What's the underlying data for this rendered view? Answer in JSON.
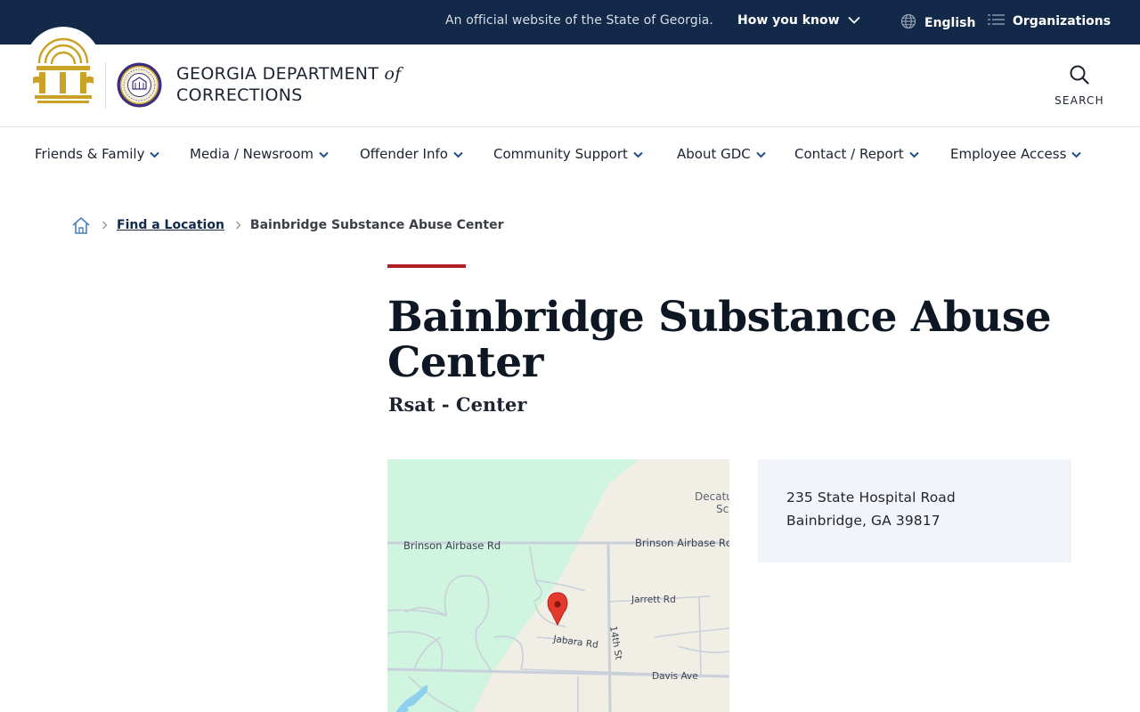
{
  "banner": {
    "official_text": "An official website of the State of Georgia.",
    "how_you_know": "How you know",
    "language": "English",
    "organizations": "Organizations"
  },
  "header": {
    "agency_line1": "GEORGIA DEPARTMENT",
    "agency_of": "of",
    "agency_line2": "CORRECTIONS",
    "search_label": "SEARCH"
  },
  "nav": {
    "items": [
      {
        "label": "Friends & Family"
      },
      {
        "label": "Media / Newsroom"
      },
      {
        "label": "Offender Info"
      },
      {
        "label": "Community Support"
      },
      {
        "label": "About GDC"
      },
      {
        "label": "Contact / Report"
      },
      {
        "label": "Employee Access"
      }
    ]
  },
  "breadcrumb": {
    "link": "Find a Location",
    "current": "Bainbridge Substance Abuse Center"
  },
  "page": {
    "title": "Bainbridge Substance Abuse Center",
    "subtitle": "Rsat - Center"
  },
  "map": {
    "labels": {
      "brinson_left": "Brinson Airbase Rd",
      "brinson_right": "Brinson Airbase Rd",
      "jarrett": "Jarrett Rd",
      "jabara": "Jabara Rd",
      "fourteenth": "14th St",
      "davis": "Davis Ave",
      "decatur_1": "Decatu",
      "decatur_2": "Sc"
    }
  },
  "address": {
    "street": "235 State Hospital Road",
    "city_state_zip": "Bainbridge, GA 39817"
  },
  "colors": {
    "banner_bg": "#12294a",
    "accent_red": "#ad1f22",
    "nav_chevron": "#1f4f8a",
    "address_bg": "#f1f4f8"
  }
}
